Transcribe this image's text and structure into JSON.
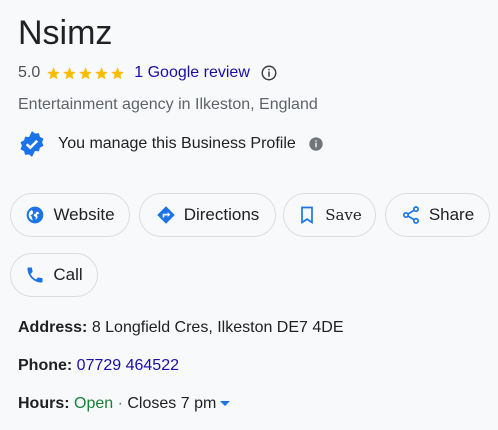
{
  "business": {
    "name": "Nsimz",
    "rating": "5.0",
    "stars": 5,
    "review_link": "1 Google review",
    "category": "Entertainment agency in Ilkeston, England",
    "manage_text": "You manage this Business Profile"
  },
  "actions": {
    "website": "Website",
    "directions": "Directions",
    "save": "Save",
    "share": "Share",
    "call": "Call"
  },
  "details": {
    "address_label": "Address:",
    "address_value": "8 Longfield Cres, Ilkeston DE7 4DE",
    "phone_label": "Phone:",
    "phone_value": "07729 464522",
    "hours_label": "Hours:",
    "hours_status": "Open",
    "hours_sep": " · ",
    "hours_closes": "Closes 7 pm"
  },
  "colors": {
    "star": "#fbbc04",
    "link": "#1a0dab",
    "accent_blue": "#1a73e8",
    "open_green": "#188038"
  },
  "icons": [
    "star-icon",
    "info-outline-icon",
    "verified-badge-icon",
    "info-filled-icon",
    "globe-icon",
    "directions-icon",
    "bookmark-icon",
    "share-icon",
    "phone-icon",
    "dropdown-caret-icon"
  ]
}
